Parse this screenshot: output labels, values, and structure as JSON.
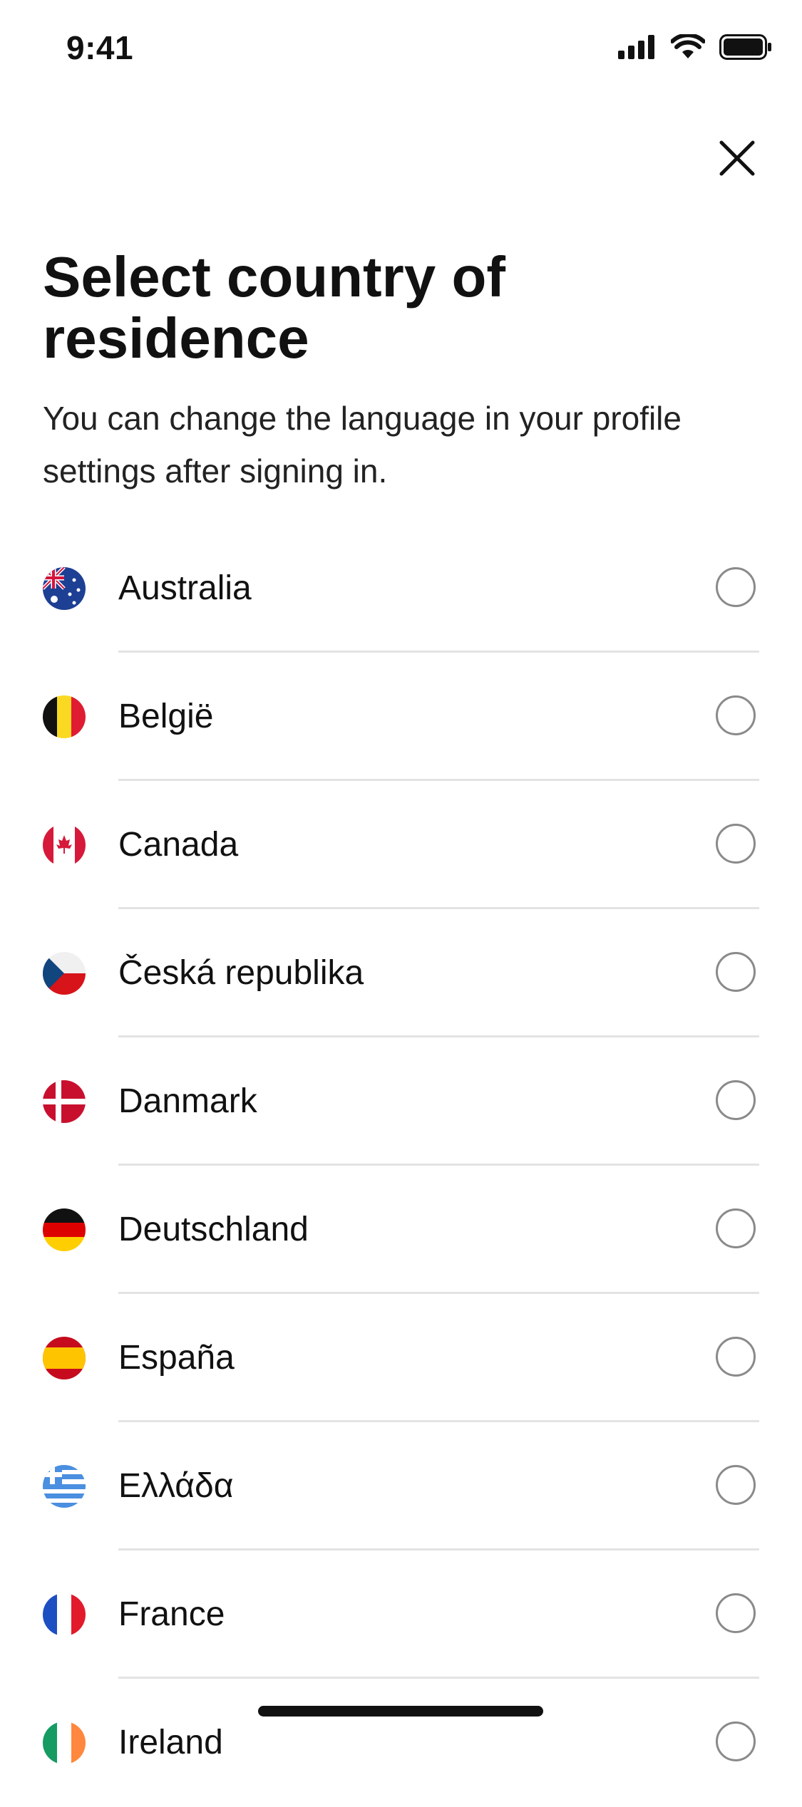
{
  "status_bar": {
    "time": "9:41",
    "icons": [
      "signal-icon",
      "wifi-icon",
      "battery-icon"
    ]
  },
  "header": {
    "close_icon": "close-icon",
    "title": "Select country of residence",
    "subtitle": "You can change the language in your profile settings after signing in."
  },
  "countries": [
    {
      "name": "Australia",
      "flag": "flag-australia-icon",
      "selected": false
    },
    {
      "name": "België",
      "flag": "flag-belgium-icon",
      "selected": false
    },
    {
      "name": "Canada",
      "flag": "flag-canada-icon",
      "selected": false
    },
    {
      "name": "Česká republika",
      "flag": "flag-czech-republic-icon",
      "selected": false
    },
    {
      "name": "Danmark",
      "flag": "flag-denmark-icon",
      "selected": false
    },
    {
      "name": "Deutschland",
      "flag": "flag-germany-icon",
      "selected": false
    },
    {
      "name": "España",
      "flag": "flag-spain-icon",
      "selected": false
    },
    {
      "name": "Ελλάδα",
      "flag": "flag-greece-icon",
      "selected": false
    },
    {
      "name": "France",
      "flag": "flag-france-icon",
      "selected": false
    },
    {
      "name": "Ireland",
      "flag": "flag-ireland-icon",
      "selected": false
    }
  ],
  "colors": {
    "background": "#ffffff",
    "text": "#111111",
    "divider": "#e3e3e3",
    "radio_border": "#8a8a8a"
  }
}
